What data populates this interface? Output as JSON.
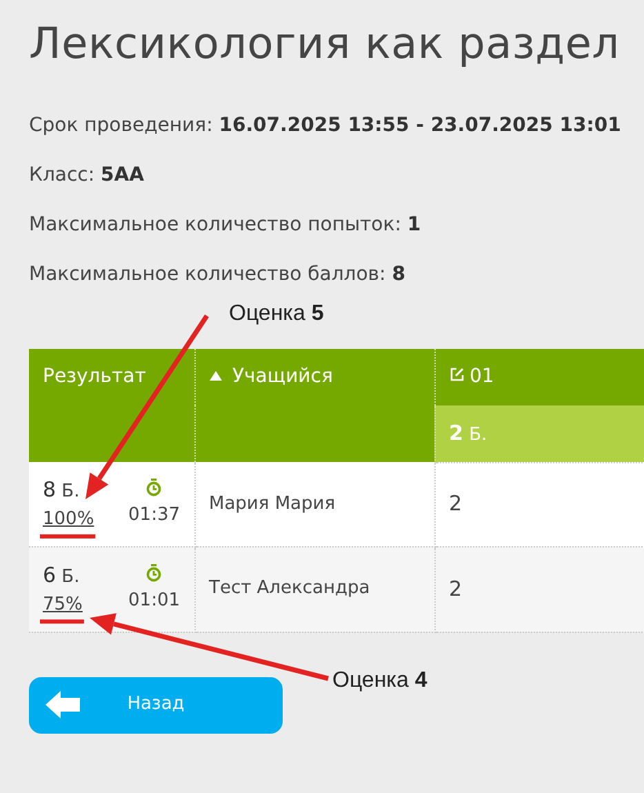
{
  "title": "Лексикология как раздел",
  "info": [
    {
      "label": "Срок проведения:",
      "value": "16.07.2025 13:55 - 23.07.2025 13:01"
    },
    {
      "label": "Класс:",
      "value": "5АА"
    },
    {
      "label": "Максимальное количество попыток:",
      "value": "1"
    },
    {
      "label": "Максимальное количество баллов:",
      "value": "8"
    }
  ],
  "table": {
    "columns": [
      {
        "label": "Результат"
      },
      {
        "label": "Учащийся"
      },
      {
        "label": "01"
      }
    ],
    "subheader": {
      "points": "2",
      "unit": "Б."
    },
    "rows": [
      {
        "score": "8",
        "unit": "Б.",
        "percent": "100%",
        "time": "01:37",
        "student": "Мария Мария",
        "column_3": "2"
      },
      {
        "score": "6",
        "unit": "Б.",
        "percent": "75%",
        "time": "01:01",
        "student": "Тест Александра",
        "column_3": "2"
      }
    ]
  },
  "back_button": {
    "label": "Назад"
  },
  "annotations": [
    {
      "text": "Оценка **5**"
    },
    {
      "text": "Оценка **4**"
    }
  ]
}
